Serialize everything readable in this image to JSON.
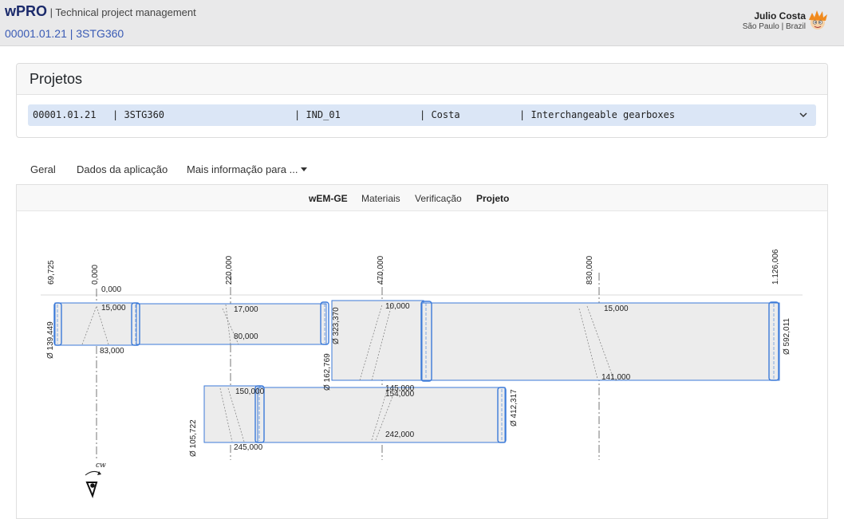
{
  "header": {
    "brand": "wPRO",
    "tagline": "| Technical project management",
    "project": "00001.01.21 | 3STG360",
    "user_name": "Julio Costa",
    "user_location": "São Paulo | Brazil",
    "avatar_icon": "avatar-icon"
  },
  "card": {
    "title": "Projetos",
    "select": {
      "col1": "00001.01.21",
      "col2": "| 3STG360",
      "col3": "| IND_01",
      "col4": "| Costa",
      "col5": "| Interchangeable gearboxes",
      "icon": "chevron-down-icon"
    }
  },
  "nav": {
    "geral": "Geral",
    "dados": "Dados da aplicação",
    "mais": "Mais informação para ..."
  },
  "subtabs": {
    "wem": "wEM-GE",
    "materiais": "Materiais",
    "verificacao": "Verificação",
    "projeto": "Projeto"
  },
  "drawing": {
    "positions": {
      "p1": "69,725",
      "p2": "0,000",
      "p3": "220,000",
      "p4": "470,000",
      "p5": "830,000",
      "p6": "1.126,006"
    },
    "labels": {
      "l_0": "0,000",
      "l_15a": "15,000",
      "l_83": "83,000",
      "l_17": "17,000",
      "l_80": "80,000",
      "l_10": "10,000",
      "l_15b": "15,000",
      "l_141": "141,000",
      "l_150": "150,000",
      "l_145": "145,000",
      "l_154": "154,000",
      "l_242": "242,000",
      "l_245": "245,000"
    },
    "diameters": {
      "d1": "Ø 139,449",
      "d2": "Ø 323,370",
      "d3": "Ø 162,769",
      "d4": "Ø 592,011",
      "d5": "Ø 105,722",
      "d6": "Ø 412,317"
    },
    "rotation_label": "cw",
    "rotation_icon": "eye-icon"
  }
}
